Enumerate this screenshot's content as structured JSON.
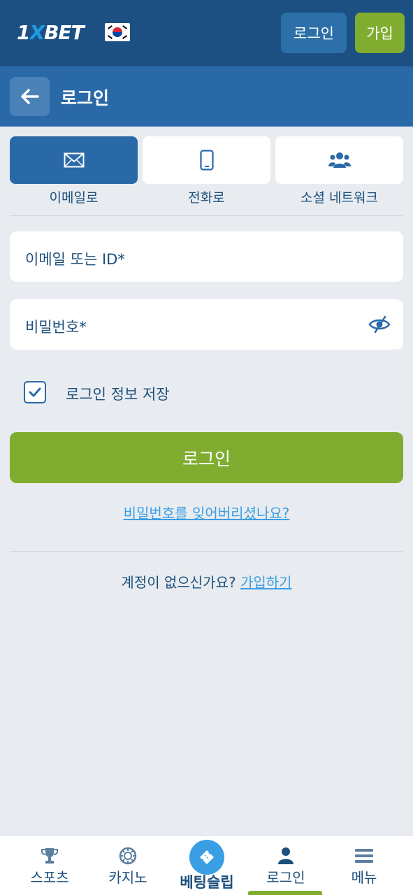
{
  "header": {
    "logo_text_a": "1",
    "logo_text_x": "X",
    "logo_text_b": "BET",
    "login_button": "로그인",
    "register_button": "가입"
  },
  "titlebar": {
    "title": "로그인"
  },
  "tabs": [
    {
      "label": "이메일로",
      "icon": "envelope-icon",
      "active": true
    },
    {
      "label": "전화로",
      "icon": "phone-icon",
      "active": false
    },
    {
      "label": "소셜 네트워크",
      "icon": "users-icon",
      "active": false
    }
  ],
  "form": {
    "email_placeholder": "이메일 또는 ID*",
    "password_placeholder": "비밀번호*",
    "remember_label": "로그인 정보 저장",
    "remember_checked": true,
    "submit_label": "로그인",
    "forgot_link": "비밀번호를 잊어버리셨나요?",
    "no_account_text": "계정이 없으신가요?",
    "signup_link": "가입하기"
  },
  "bottom_nav": {
    "items": [
      {
        "label": "스포츠",
        "icon": "trophy-icon"
      },
      {
        "label": "카지노",
        "icon": "casino-chip-icon"
      },
      {
        "label": "베팅슬립",
        "icon": "ticket-icon"
      },
      {
        "label": "로그인",
        "icon": "user-icon",
        "active": true
      },
      {
        "label": "메뉴",
        "icon": "hamburger-icon"
      }
    ]
  },
  "colors": {
    "header_bg": "#1c5083",
    "titlebar_bg": "#2a69a8",
    "accent_green": "#80ad30",
    "link_blue": "#3a9ee4",
    "text_dark_blue": "#1d4f7c",
    "page_bg": "#e8ecf0"
  }
}
